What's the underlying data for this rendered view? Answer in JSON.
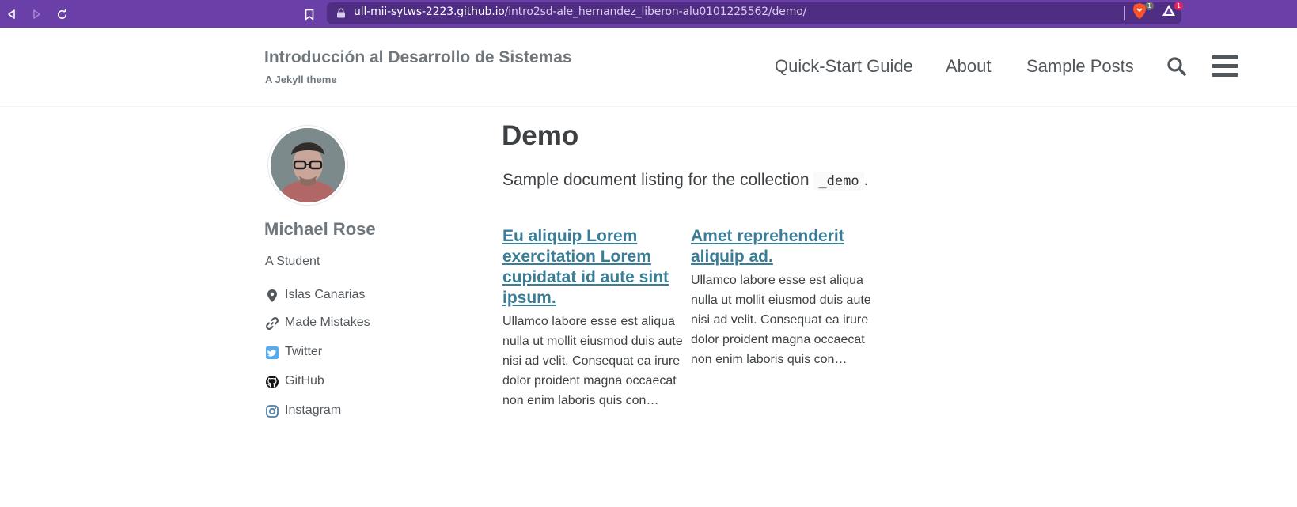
{
  "browser": {
    "url_host": "ull-mii-sytws-2223.github.io",
    "url_path": "/intro2sd-ale_hernandez_liberon-alu0101225562/demo/",
    "extension_badge_1": "1",
    "extension_badge_2": "1",
    "theme_color": "#6a3fa7"
  },
  "masthead": {
    "site_title": "Introducción al Desarrollo de Sistemas",
    "site_subtitle": "A Jekyll theme",
    "nav": [
      {
        "label": "Quick-Start Guide"
      },
      {
        "label": "About"
      },
      {
        "label": "Sample Posts"
      }
    ],
    "search_icon": "search-icon",
    "menu_icon": "hamburger-menu-icon"
  },
  "author": {
    "name": "Michael Rose",
    "bio": "A Student",
    "links": [
      {
        "label": "Islas Canarias",
        "icon": "map-marker-icon"
      },
      {
        "label": "Made Mistakes",
        "icon": "link-icon"
      },
      {
        "label": "Twitter",
        "icon": "twitter-icon"
      },
      {
        "label": "GitHub",
        "icon": "github-icon"
      },
      {
        "label": "Instagram",
        "icon": "instagram-icon"
      }
    ]
  },
  "main": {
    "title": "Demo",
    "description_prefix": "Sample document listing for the collection",
    "description_code": "_demo",
    "description_suffix": ".",
    "documents": [
      {
        "title": "Eu aliquip Lorem exercitation Lorem cupidatat id aute sint ipsum.",
        "excerpt": "Ullamco labore esse est aliqua nulla ut mollit eiusmod duis aute nisi ad velit. Consequat ea irure dolor proident magna occaecat non enim laboris quis con…"
      },
      {
        "title": "Amet reprehenderit aliquip ad.",
        "excerpt": "Ullamco labore esse est aliqua nulla ut mollit eiusmod duis aute nisi ad velit. Consequat ea irure dolor proident magna occaecat non enim laboris quis con…"
      }
    ],
    "link_color": "#3a7d97"
  }
}
